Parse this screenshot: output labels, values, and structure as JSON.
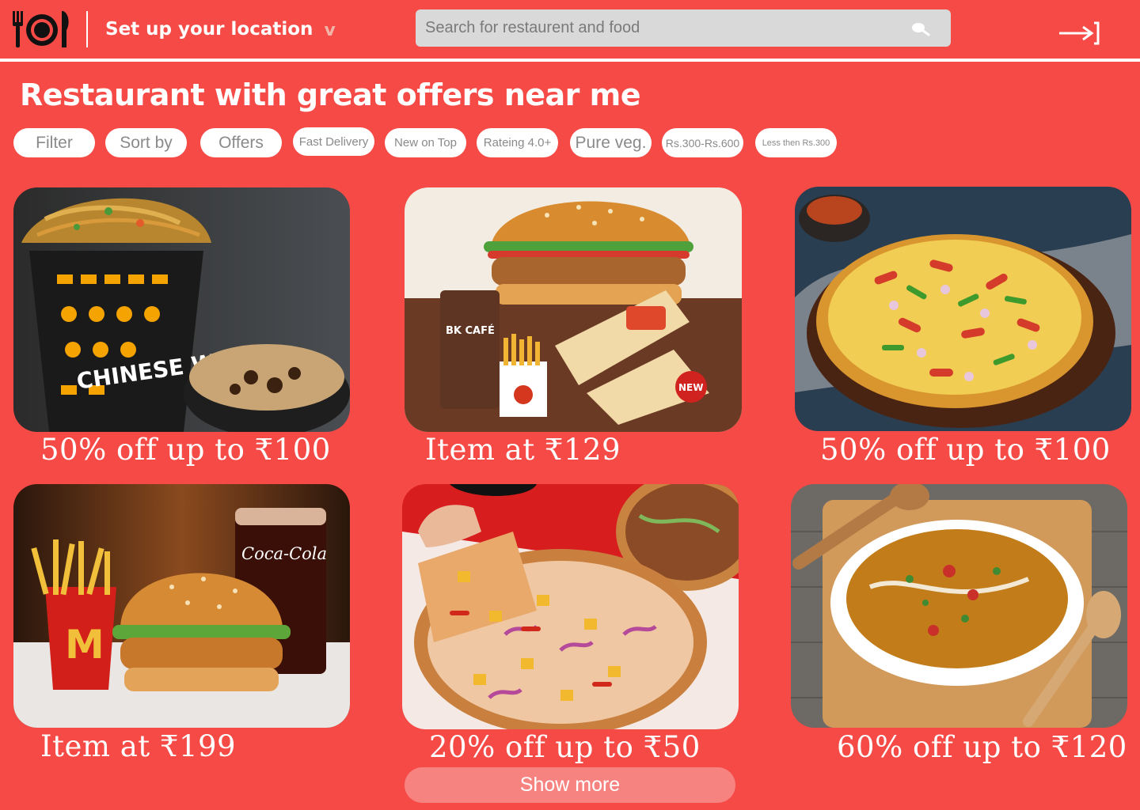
{
  "header": {
    "location_label": "Set up your location",
    "location_chevron": "v",
    "search_placeholder": "Search for restaurent and food",
    "icons": {
      "logo": "plate-fork-knife-icon",
      "search": "search-icon",
      "logout": "arrow-right-bracket-icon"
    }
  },
  "page": {
    "title": "Restaurant with great offers near me"
  },
  "filters": [
    "Filter",
    "Sort by",
    "Offers",
    "Fast Delivery",
    "New on Top",
    "Rateing 4.0+",
    "Pure veg.",
    "Rs.300-Rs.600",
    "Less then Rs.300"
  ],
  "cards": [
    {
      "offer": "50% off up to ₹100",
      "image": "chinese-wok-noodles-bucket"
    },
    {
      "offer": "Item at ₹129",
      "image": "burger-king-meal"
    },
    {
      "offer": "50% off up to ₹100",
      "image": "veg-pizza"
    },
    {
      "offer": "Item at ₹199",
      "image": "mcdonalds-burger-meal"
    },
    {
      "offer": "20% off up to ₹50",
      "image": "pizza-hut-paneer-pizza"
    },
    {
      "offer": "60% off up to ₹120",
      "image": "curry-dish"
    }
  ],
  "image_text": {
    "card0_brand": "CHINESE WOK",
    "card1_cup": "BK CAFÉ",
    "card1_badge": "NEW",
    "card3_brand": "Coca-Cola"
  },
  "actions": {
    "show_more": "Show more"
  },
  "colors": {
    "background": "#f54a45",
    "search_bg": "#d9d9d9",
    "chip_bg": "#ffffff",
    "chip_text": "#8a8a8a",
    "show_more_bg": "#f68380"
  }
}
